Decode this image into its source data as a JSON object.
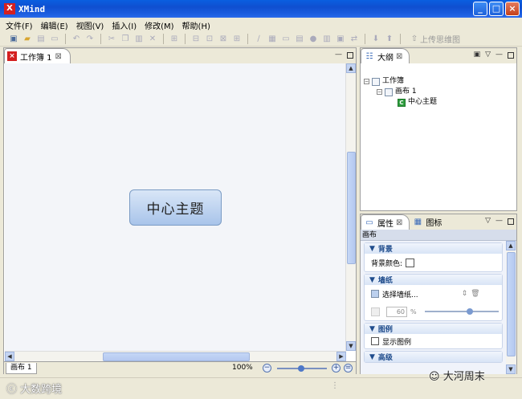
{
  "window": {
    "title": "XMind",
    "logo": "X",
    "minimize": "_",
    "maximize": "□",
    "close": "×"
  },
  "menu": [
    "文件(F)",
    "编辑(E)",
    "视图(V)",
    "插入(I)",
    "修改(M)",
    "帮助(H)"
  ],
  "toolbar": {
    "upload_label": "上传思维图"
  },
  "editor": {
    "tab_label": "工作簿 1",
    "central_topic": "中心主题",
    "sheet_tab": "画布 1",
    "zoom": "100%"
  },
  "outline": {
    "tab_label": "大纲",
    "tree": [
      {
        "label": "工作簿",
        "level": 0
      },
      {
        "label": "画布 1",
        "level": 1
      },
      {
        "label": "中心主题",
        "level": 2
      }
    ]
  },
  "properties": {
    "tab_label": "属性",
    "second_tab_label": "图标",
    "header": "画布",
    "sections": {
      "background": {
        "title": "背景",
        "color_label": "背景颜色:"
      },
      "wallpaper": {
        "title": "墙纸",
        "select_label": "选择墙纸...",
        "opacity_value": "60",
        "opacity_unit": "%"
      },
      "legend": {
        "title": "图例",
        "show_label": "显示图例"
      },
      "advanced": {
        "title": "高级"
      }
    }
  },
  "watermarks": {
    "left": "大数跨境",
    "right": "大河周末"
  },
  "colors": {
    "title_bar": "#0F4FD0",
    "topic_fill": "#B9D0F0",
    "canvas": "#F3F5F9"
  }
}
